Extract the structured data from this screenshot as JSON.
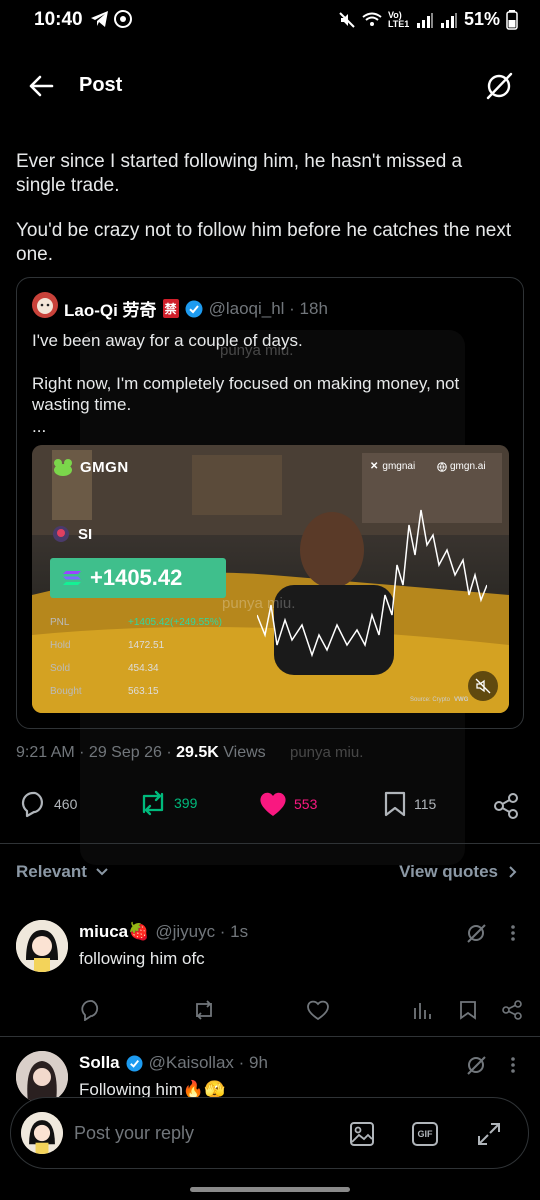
{
  "status_bar": {
    "time": "10:40",
    "battery": "51%",
    "volte": "Vo) LTE1"
  },
  "header": {
    "title": "Post"
  },
  "post": {
    "text_1": "Ever since I started following him, he hasn't missed a single trade.",
    "text_2": "You'd be crazy not to follow him before he catches the next one.",
    "timestamp": "9:21 AM · 29 Sep 26 ·",
    "views_count": "29.5K",
    "views_label": "Views",
    "actions": {
      "replies": "460",
      "reposts": "399",
      "likes": "553",
      "bookmarks": "115"
    }
  },
  "quote": {
    "name": "Lao-Qi 劳奇",
    "emoji_badge": "禁",
    "handle": "@laoqi_hl · 18h",
    "text_1": "I've been away for a couple of days.",
    "text_2": "Right now, I'm completely focused on making money, not wasting time.",
    "text_3": "...",
    "media": {
      "brand": "GMGN",
      "x_handle": "gmgnai",
      "site": "gmgn.ai",
      "token": "SI",
      "pnl_big": "+1405.42",
      "rows": [
        {
          "label": "PNL",
          "value": "+1405.42(+249.55%)"
        },
        {
          "label": "Hold",
          "value": "1472.51"
        },
        {
          "label": "Sold",
          "value": "454.34"
        },
        {
          "label": "Bought",
          "value": "563.15"
        }
      ],
      "source": "Source: Crypto",
      "source_tag": "VWG"
    }
  },
  "filter": {
    "relevant_label": "Relevant",
    "view_quotes_label": "View quotes"
  },
  "replies": [
    {
      "name": "miuca🍓",
      "handle": "@jiyuyc · 1s",
      "text": "following him ofc"
    },
    {
      "name": "Solla",
      "handle": "@Kaisollax · 9h",
      "text": "Following him🔥🫣"
    }
  ],
  "reply_bar": {
    "placeholder": "Post your reply",
    "gif_label": "GIF"
  },
  "watermark": {
    "text": "punya miu."
  },
  "colors": {
    "accent_blue": "#1d9bf0",
    "repost_green": "#00ba7c",
    "like_pink": "#f91880",
    "pnl_green": "#2fd8a0"
  }
}
